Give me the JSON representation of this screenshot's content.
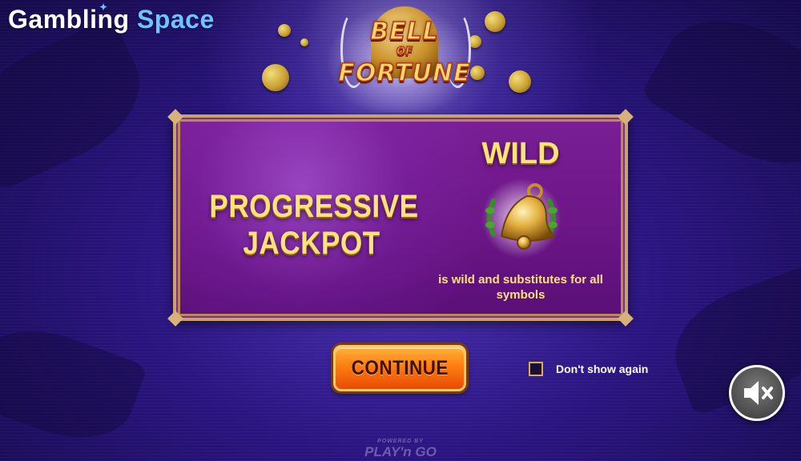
{
  "brand": {
    "part1": "Gambling",
    "part2": "Space"
  },
  "game_logo": {
    "line1": "BELL",
    "line2": "OF",
    "line3": "FORTUNE"
  },
  "info_panel": {
    "left_feature": "PROGRESSIVE JACKPOT",
    "wild_title": "WILD",
    "wild_icon": "golden-bell-icon",
    "wild_description": "is wild and substitutes for all symbols"
  },
  "controls": {
    "continue_label": "CONTINUE",
    "dont_show_label": "Don't show again",
    "dont_show_checked": false,
    "mute_icon": "speaker-muted-icon"
  },
  "footer": {
    "powered_by": "POWERED BY",
    "provider": "PLAY'n GO"
  },
  "colors": {
    "gold_text": "#ffe27a",
    "panel_purple": "#6a1585",
    "button_orange": "#ff7d12",
    "brand_blue": "#6fc3ff"
  }
}
